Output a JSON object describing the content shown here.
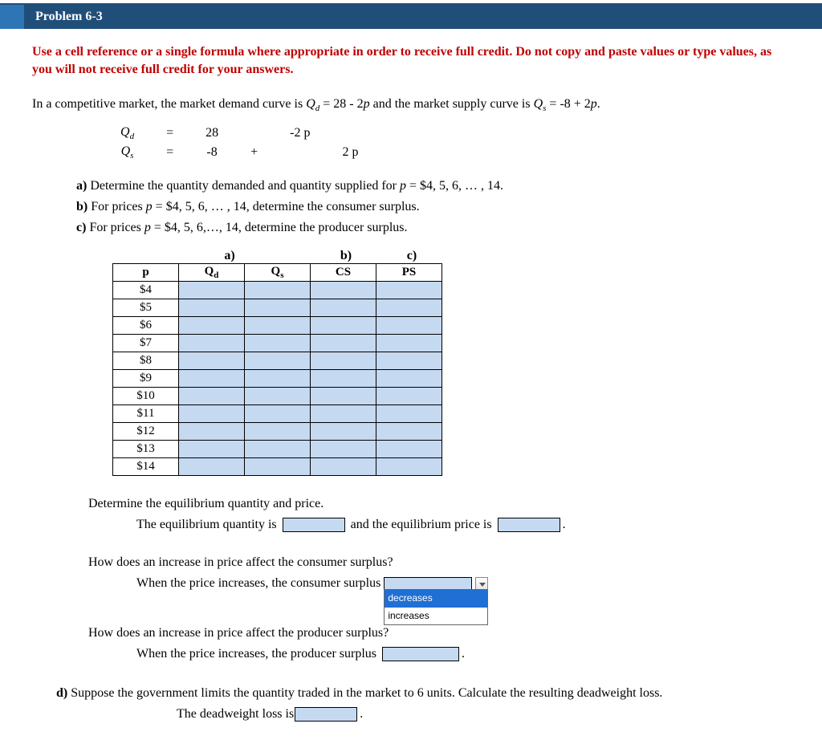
{
  "header": {
    "title": "Problem 6-3"
  },
  "instruction": "Use a cell reference or a single formula where appropriate in order to receive full credit. Do not copy and paste values or type values, as you will not receive full credit for your answers.",
  "intro_pre": "In a competitive market, the market demand curve is ",
  "intro_mid": " = 28 - 2",
  "intro_mid2": "  and the market supply curve is ",
  "intro_post": " = -8 + 2",
  "intro_end": ".",
  "symbol_Qd": "Q",
  "symbol_Qd_sub": "d",
  "symbol_Qs": "Q",
  "symbol_Qs_sub": "s",
  "symbol_p": "p",
  "equations": {
    "row1": {
      "lhs_sym": "Q",
      "lhs_sub": "d",
      "eq": "=",
      "c1": "28",
      "c2": "",
      "c3": "-2 p",
      "c4": ""
    },
    "row2": {
      "lhs_sym": "Q",
      "lhs_sub": "s",
      "eq": "=",
      "c1": "-8",
      "c2": "+",
      "c3": "",
      "c4": "2 p"
    }
  },
  "parts": {
    "a_label": "a)",
    "a_text": " Determine the quantity demanded and quantity supplied for ",
    "a_tail": " = $4, 5, 6, … , 14.",
    "b_label": "b)",
    "b_text": " For prices ",
    "b_tail": " = $4, 5, 6, … , 14, determine the consumer surplus.",
    "c_label": "c)",
    "c_text": " For prices ",
    "c_tail": " = $4, 5, 6,…, 14, determine the producer surplus."
  },
  "colhdr": {
    "a": "a)",
    "b": "b)",
    "c": "c)"
  },
  "table": {
    "headers": {
      "p": "p",
      "qd": "Q",
      "qd_sub": "d",
      "qs": "Q",
      "qs_sub": "s",
      "cs": "CS",
      "ps": "PS"
    },
    "rows": [
      "$4",
      "$5",
      "$6",
      "$7",
      "$8",
      "$9",
      "$10",
      "$11",
      "$12",
      "$13",
      "$14"
    ]
  },
  "eq_section": {
    "line1": "Determine the equilibrium quantity and price.",
    "line2a": "The equilibrium quantity is",
    "line2b": "and the equilibrium price is",
    "period": "."
  },
  "cs_section": {
    "q": "How does an increase in price affect the consumer surplus?",
    "a": "When the price increases, the consumer surplus",
    "options": [
      "decreases",
      "increases"
    ]
  },
  "ps_section": {
    "q": "How does an increase in price affect the producer surplus?",
    "a": "When the price increases, the producer surplus",
    "period": "."
  },
  "part_d": {
    "label": "d)",
    "text": " Suppose the government limits the quantity traded in the market to 6 units. Calculate the resulting deadweight loss.",
    "ans": "The deadweight loss is",
    "period": "."
  }
}
